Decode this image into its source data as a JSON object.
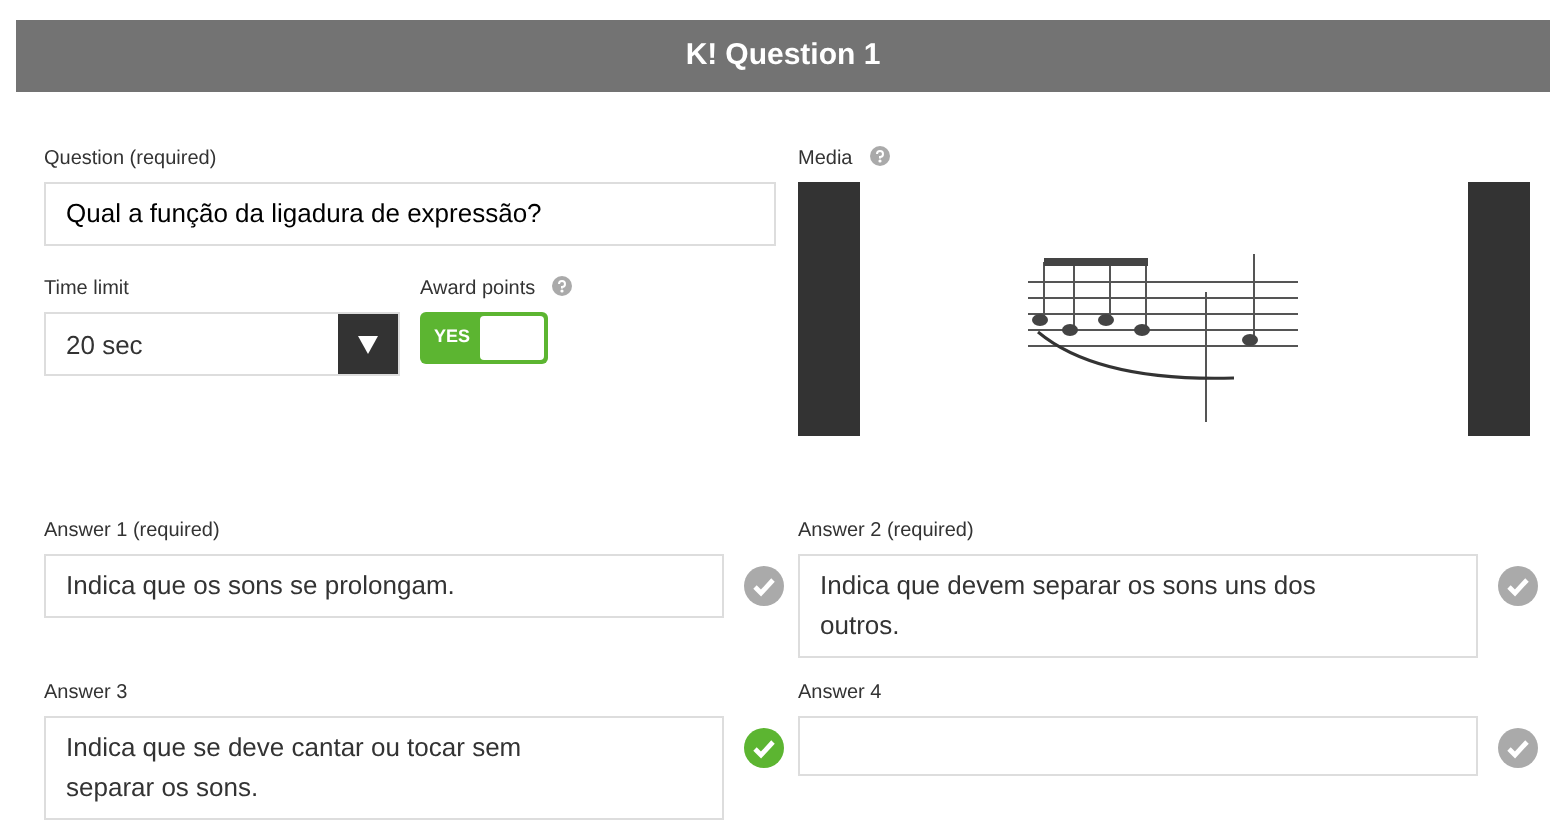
{
  "header": {
    "logo": "K!",
    "title": "Question 1"
  },
  "question": {
    "label": "Question (required)",
    "value": "Qual a função da ligadura de expressão?"
  },
  "time_limit": {
    "label": "Time limit",
    "value": "20 sec"
  },
  "award_points": {
    "label": "Award points",
    "toggle_text": "YES",
    "on": true
  },
  "media": {
    "label": "Media",
    "kind": "picture"
  },
  "answers": [
    {
      "label": "Answer 1 (required)",
      "value": "Indica que os sons se prolongam.",
      "correct": false
    },
    {
      "label": "Answer 2 (required)",
      "value": "Indica que devem separar os sons uns dos outros.",
      "correct": false
    },
    {
      "label": "Answer 3",
      "value": "Indica que se deve cantar ou tocar sem separar os sons.",
      "correct": true
    },
    {
      "label": "Answer 4",
      "correct": false
    }
  ]
}
